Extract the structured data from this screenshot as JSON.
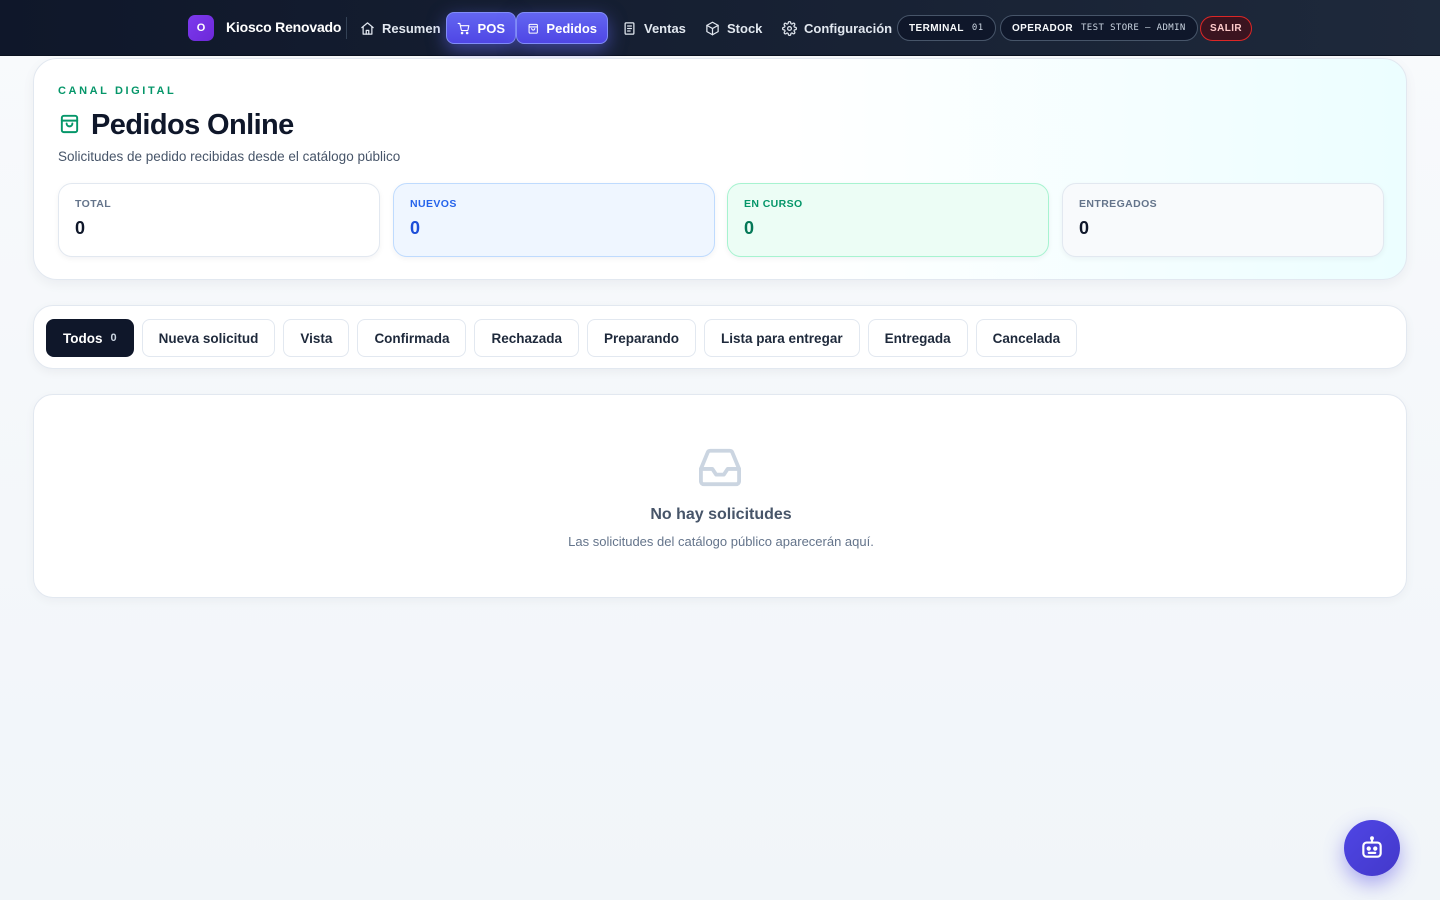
{
  "app": {
    "logo_letter": "O",
    "name": "Kiosco Renovado"
  },
  "nav": {
    "items": [
      {
        "label": "Resumen",
        "icon": "home-icon"
      },
      {
        "label": "POS",
        "icon": "cart-icon"
      },
      {
        "label": "Pedidos",
        "icon": "shopping-bag-icon"
      },
      {
        "label": "Ventas",
        "icon": "receipt-icon"
      },
      {
        "label": "Stock",
        "icon": "box-icon"
      },
      {
        "label": "Configuración",
        "icon": "gear-icon"
      }
    ],
    "terminal_label": "TERMINAL",
    "terminal_value": "01",
    "operator_label": "OPERADOR",
    "operator_value": "TEST STORE — ADMIN",
    "logout_label": "SALIR",
    "accent_color": "#6366f1"
  },
  "header": {
    "eyebrow": "CANAL DIGITAL",
    "title": "Pedidos Online",
    "title_icon": "shopping-bag-icon",
    "subtitle": "Solicitudes de pedido recibidas desde el catálogo público",
    "stats": [
      {
        "label": "TOTAL",
        "value": "0"
      },
      {
        "label": "NUEVOS",
        "value": "0"
      },
      {
        "label": "EN CURSO",
        "value": "0"
      },
      {
        "label": "ENTREGADOS",
        "value": "0"
      }
    ]
  },
  "filters": {
    "items": [
      {
        "label": "Todos",
        "count": "0"
      },
      {
        "label": "Nueva solicitud"
      },
      {
        "label": "Vista"
      },
      {
        "label": "Confirmada"
      },
      {
        "label": "Rechazada"
      },
      {
        "label": "Preparando"
      },
      {
        "label": "Lista para entregar"
      },
      {
        "label": "Entregada"
      },
      {
        "label": "Cancelada"
      }
    ],
    "selected": "Todos"
  },
  "empty_state": {
    "icon": "inbox-icon",
    "title": "No hay solicitudes",
    "subtitle": "Las solicitudes del catálogo público aparecerán aquí."
  },
  "assistant": {
    "icon": "robot-icon"
  }
}
